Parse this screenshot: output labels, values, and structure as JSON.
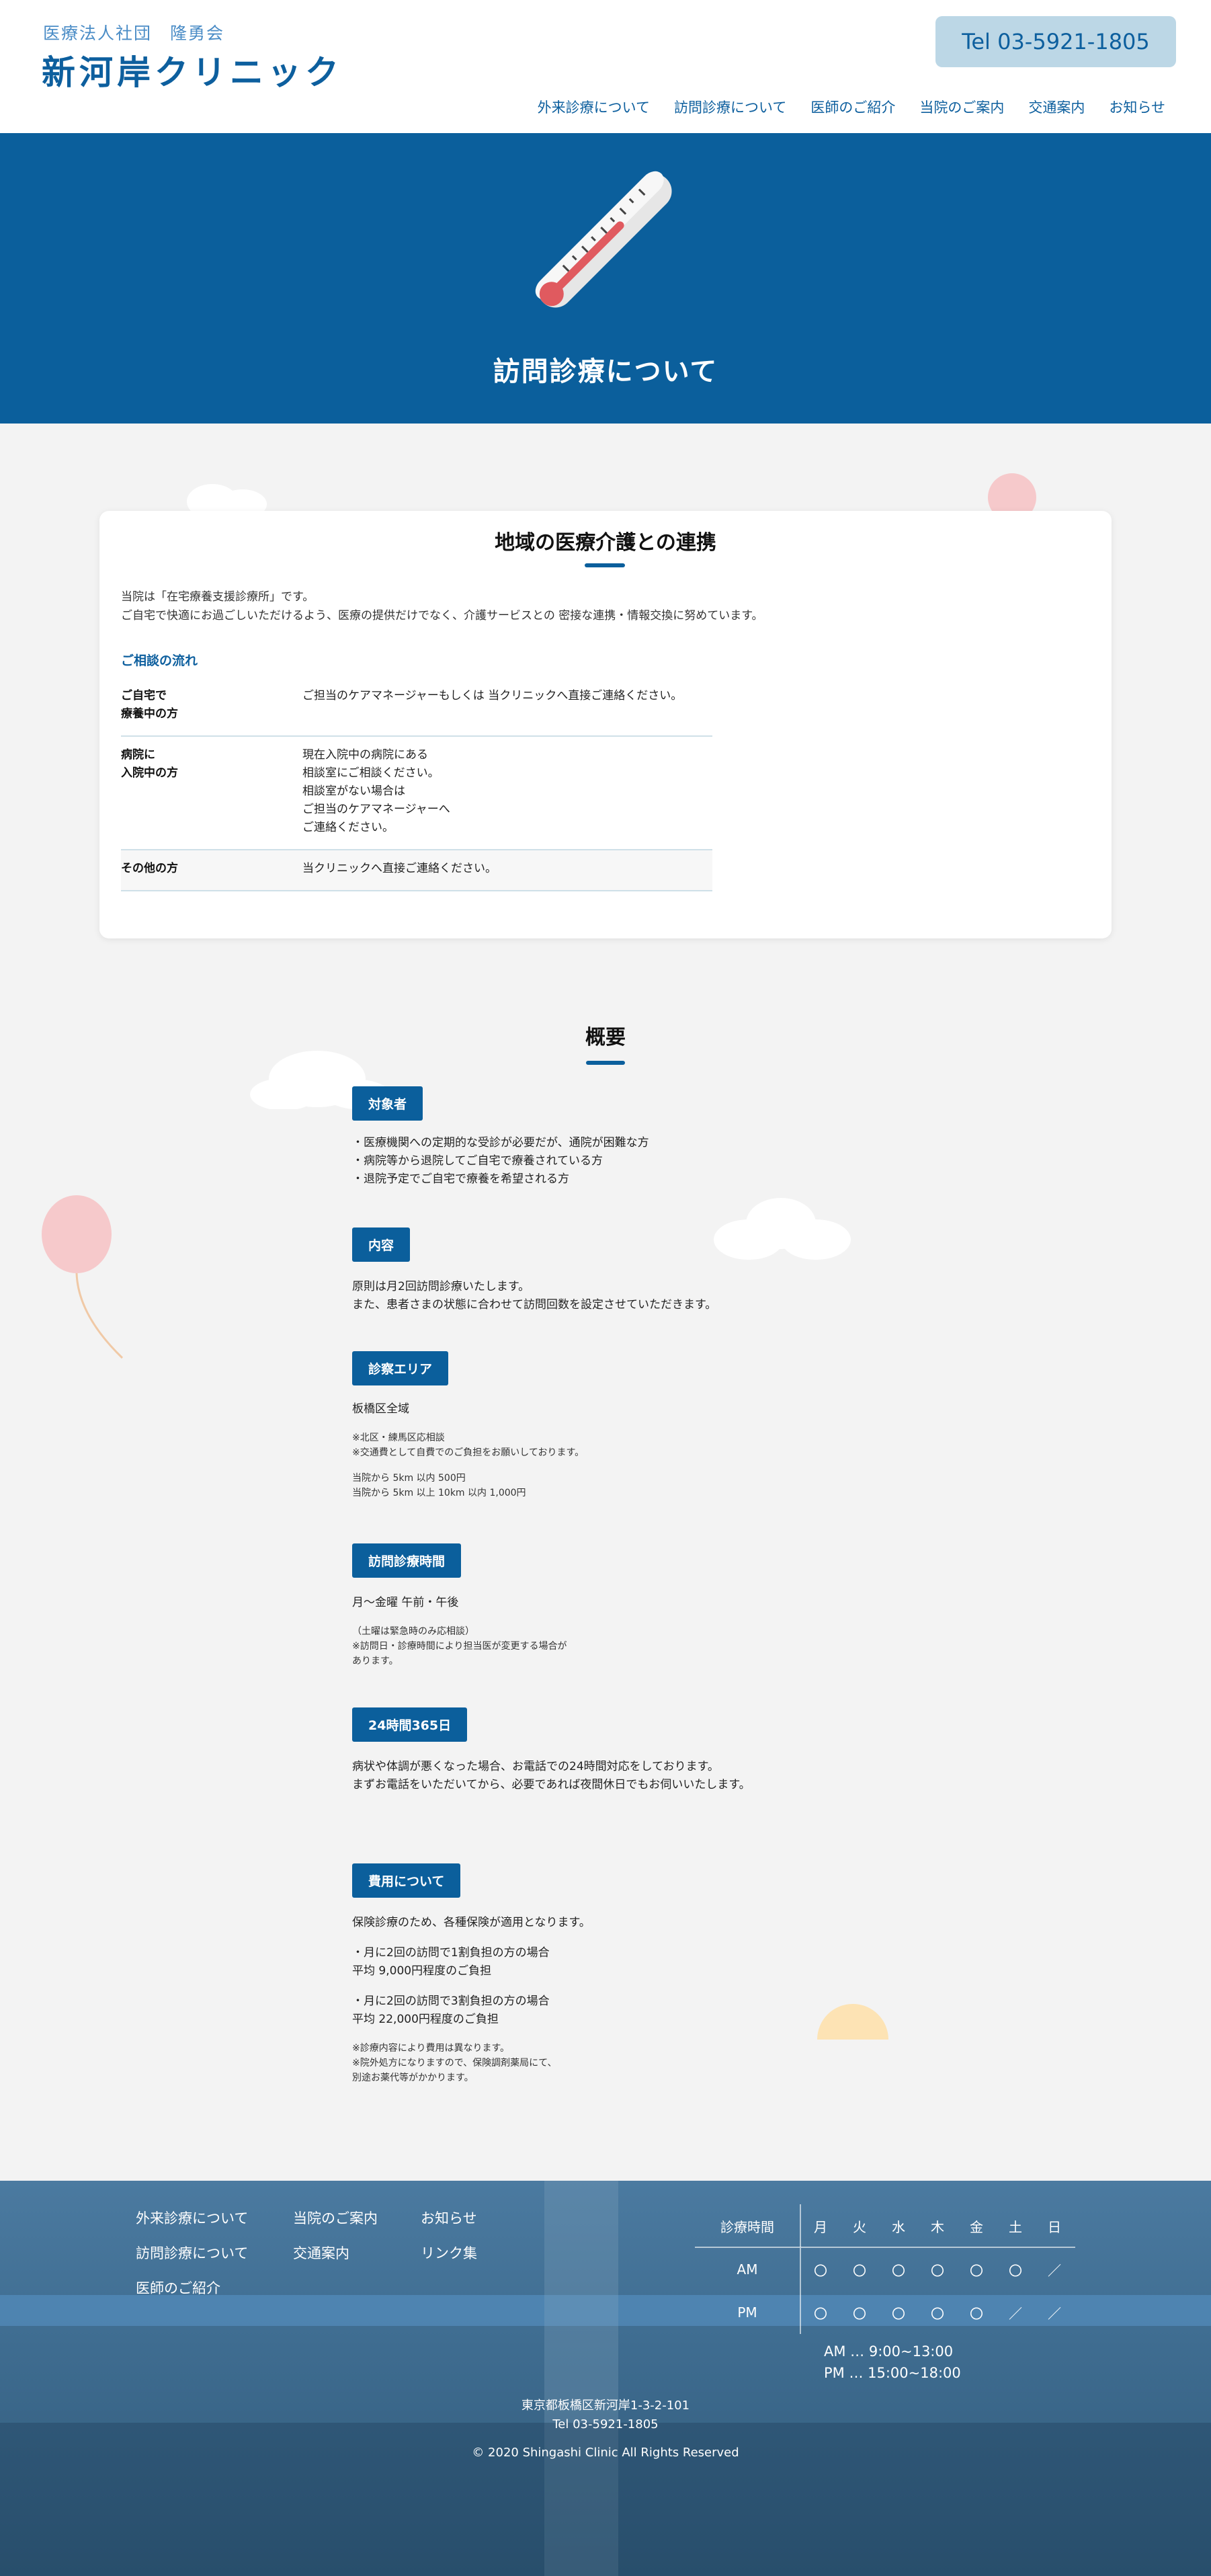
{
  "header": {
    "logo_sub": "医療法人社団　隆勇会",
    "logo_main": "新河岸クリニック",
    "tel": "Tel 03-5921-1805",
    "nav": [
      "外来診療について",
      "訪問診療について",
      "医師のご紹介",
      "当院のご案内",
      "交通案内",
      "お知らせ"
    ]
  },
  "hero": {
    "title": "訪問診療について"
  },
  "card": {
    "title": "地域の医療介護との連携",
    "intro": "当院は「在宅療養支援診療所」です。\nご自宅で快適にお過ごしいただけるよう、医療の提供だけでなく、介護サービスとの 密接な連携・情報交換に努めています。",
    "subtitle": "ご相談の流れ",
    "rows": [
      {
        "head": "ご自宅で\n療養中の方",
        "body": "ご担当のケアマネージャーもしくは 当クリニックへ直接ご連絡ください。"
      },
      {
        "head": "病院に\n入院中の方",
        "body": "現在入院中の病院にある\n相談室にご相談ください。\n相談室がない場合は\nご担当のケアマネージャーへ\nご連絡ください。"
      },
      {
        "head": "その他の方",
        "body": "当クリニックへ直接ご連絡ください。"
      }
    ]
  },
  "overview": {
    "title": "概要",
    "target_tag": "対象者",
    "target_text": "・医療機関への定期的な受診が必要だが、通院が困難な方\n・病院等から退院してご自宅で療養されている方\n・退院予定でご自宅で療養を希望される方",
    "content_tag": "内容",
    "content_text": "原則は月2回訪問診療いたします。\nまた、患者さまの状態に合わせて訪問回数を設定させていただきます。",
    "area_tag": "診察エリア",
    "area_text": "板橋区全域",
    "area_note1": "※北区・練馬区応相談\n※交通費として自費でのご負担をお願いしております。",
    "area_note2": "当院から 5km 以内 500円\n当院から 5km 以上 10km 以内 1,000円",
    "time_tag": "訪問診療時間",
    "time_text": "月～金曜 午前・午後",
    "time_note": "（土曜は緊急時のみ応相談）\n※訪問日・診療時間により担当医が変更する場合が\nあります。",
    "h24_tag": "24時間365日",
    "h24_text": "病状や体調が悪くなった場合、お電話での24時間対応をしております。\nまずお電話をいただいてから、必要であれば夜間休日でもお伺いいたします。",
    "fee_tag": "費用について",
    "fee_text1": "保険診療のため、各種保険が適用となります。",
    "fee_text2": "・月に2回の訪問で1割負担の方の場合\n平均 9,000円程度のご負担",
    "fee_text3": "・月に2回の訪問で3割負担の方の場合\n平均 22,000円程度のご負担",
    "fee_note": "※診療内容により費用は異なります。\n※院外処方になりますので、保険調剤薬局にて、\n別途お薬代等がかかります。"
  },
  "footer": {
    "nav_col1": [
      "外来診療について",
      "訪問診療について",
      "医師のご紹介"
    ],
    "nav_col2": [
      "当院のご案内",
      "交通案内"
    ],
    "nav_col3": [
      "お知らせ",
      "リンク集"
    ],
    "schedule": {
      "label": "診療時間",
      "days": [
        "月",
        "火",
        "水",
        "木",
        "金",
        "土",
        "日"
      ],
      "am_label": "AM",
      "am": [
        "〇",
        "〇",
        "〇",
        "〇",
        "〇",
        "〇",
        "／"
      ],
      "pm_label": "PM",
      "pm": [
        "〇",
        "〇",
        "〇",
        "〇",
        "〇",
        "／",
        "／"
      ]
    },
    "hours": "AM … 9:00~13:00\nPM … 15:00~18:00",
    "address": "東京都板橋区新河岸1-3-2-101",
    "tel": "Tel 03-5921-1805",
    "copyright": "© 2020 Shingashi Clinic All Rights Reserved"
  },
  "colors": {
    "primary": "#0b5f9c",
    "accent_light": "#bcd7e6",
    "balloon_pink": "#f6c9cb",
    "sun": "#fde3b4"
  }
}
